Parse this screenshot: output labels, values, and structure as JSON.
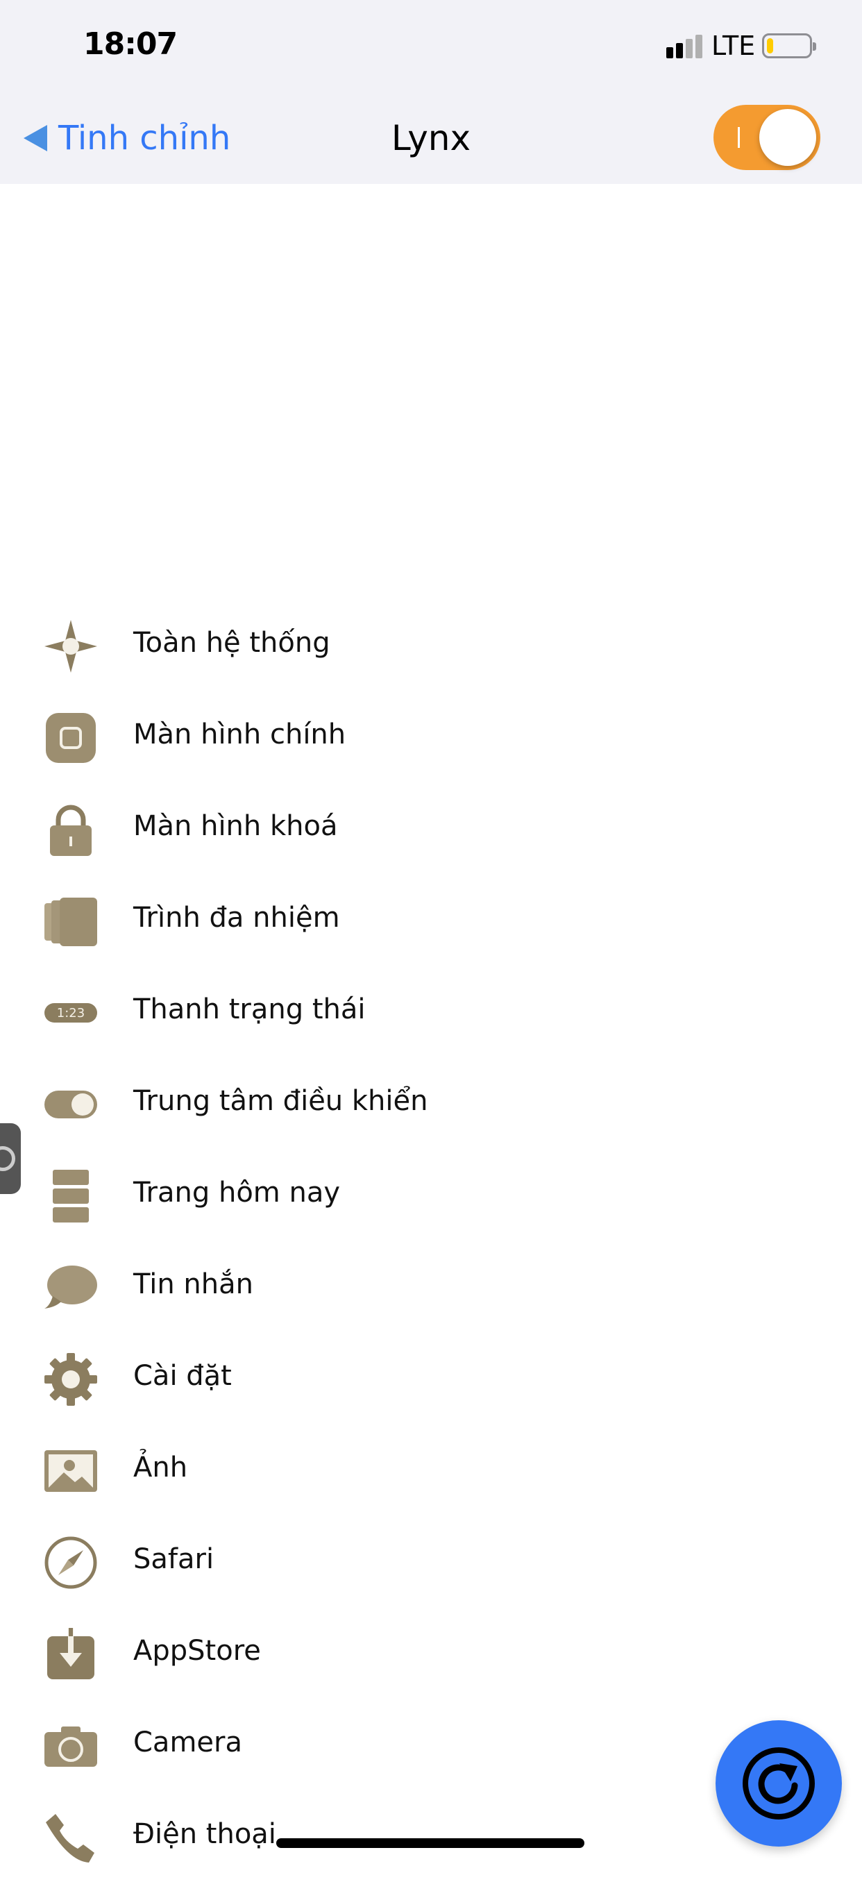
{
  "status_bar": {
    "time": "18:07",
    "network": "LTE",
    "battery_level": 0.15,
    "battery_color": "#ffcc00"
  },
  "nav": {
    "back_label": "Tinh chỉnh",
    "title": "Lynx",
    "enabled": true,
    "accent": "#f49b30",
    "link_color": "#3478f6"
  },
  "logo": {
    "icon": "lynx-head-icon",
    "color": "#a89a7a"
  },
  "menu": {
    "items": [
      {
        "label": "Toàn hệ thống",
        "icon": "system-wide-icon"
      },
      {
        "label": "Màn hình chính",
        "icon": "home-screen-icon"
      },
      {
        "label": "Màn hình khoá",
        "icon": "lock-icon"
      },
      {
        "label": "Trình đa nhiệm",
        "icon": "multitask-icon"
      },
      {
        "label": "Thanh trạng thái",
        "icon": "status-bar-icon",
        "icon_text": "1:23"
      },
      {
        "label": "Trung tâm điều khiển",
        "icon": "control-center-toggle-icon"
      },
      {
        "label": "Trang hôm nay",
        "icon": "today-view-icon"
      },
      {
        "label": "Tin nhắn",
        "icon": "message-bubble-icon"
      },
      {
        "label": "Cài đặt",
        "icon": "gear-icon"
      },
      {
        "label": "Ảnh",
        "icon": "photo-icon"
      },
      {
        "label": "Safari",
        "icon": "compass-icon"
      },
      {
        "label": "AppStore",
        "icon": "download-icon"
      },
      {
        "label": "Camera",
        "icon": "camera-icon"
      },
      {
        "label": "Điện thoại",
        "icon": "phone-icon"
      }
    ]
  },
  "fab": {
    "icon": "refresh-icon",
    "color": "#3478f6"
  }
}
